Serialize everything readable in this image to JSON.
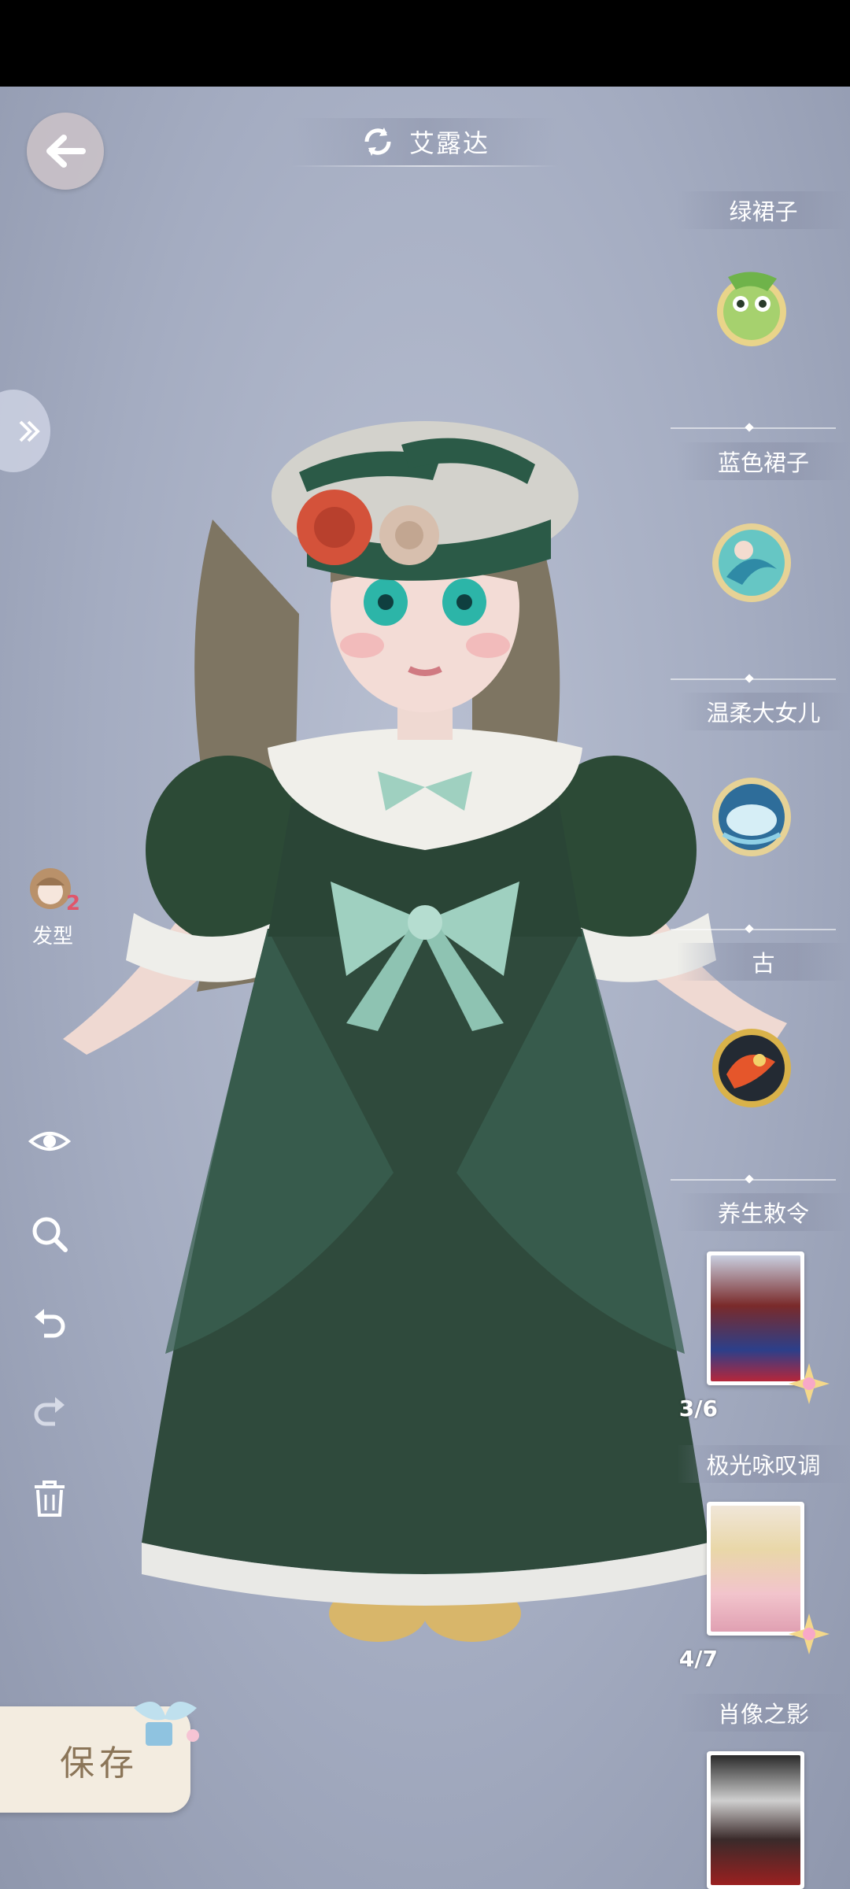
{
  "header": {
    "title": "艾露达"
  },
  "toolbar": {
    "hair_label": "发型",
    "hair_count": "2"
  },
  "collections": [
    {
      "label": "绿裙子",
      "kind": "badge",
      "icon": "frog-badge-icon"
    },
    {
      "label": "蓝色裙子",
      "kind": "badge",
      "icon": "mermaid-badge-icon"
    },
    {
      "label": "温柔大女儿",
      "kind": "badge",
      "icon": "whale-badge-icon"
    },
    {
      "label": "古",
      "kind": "badge",
      "icon": "koi-badge-icon"
    },
    {
      "label": "养生敕令",
      "kind": "card",
      "progress": "3/6"
    },
    {
      "label": "极光咏叹调",
      "kind": "card",
      "progress": "4/7"
    },
    {
      "label": "肖像之影",
      "kind": "card",
      "progress": ""
    }
  ],
  "actions": {
    "save_label": "保存"
  },
  "colors": {
    "dress": "#2f4a3c",
    "bow": "#9fd0c0",
    "background": "#a4acc1"
  }
}
